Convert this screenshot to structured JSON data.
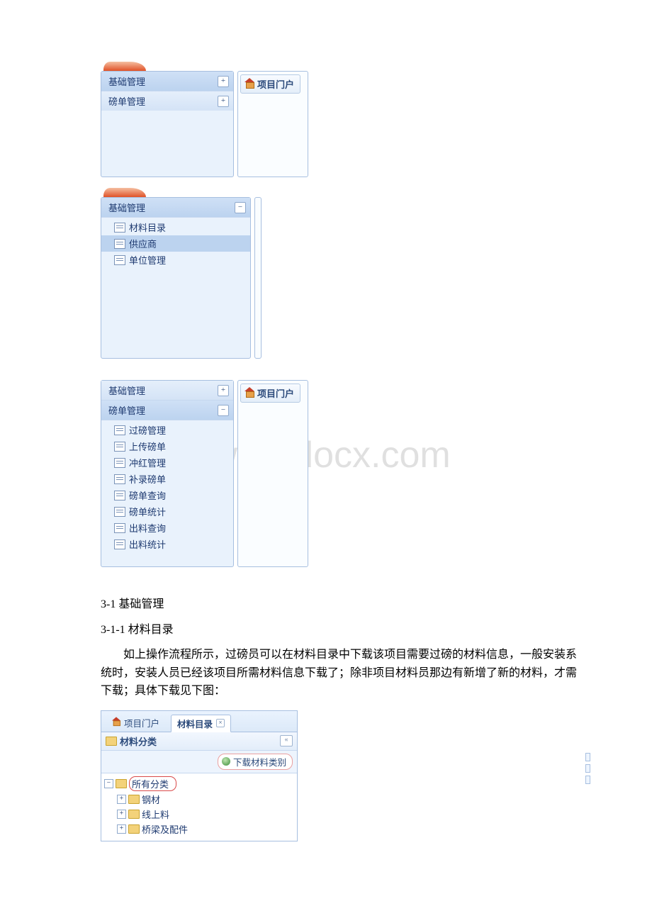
{
  "nav": {
    "basic": "基础管理",
    "weigh": "磅单管理",
    "basic_items": [
      "材料目录",
      "供应商",
      "单位管理"
    ],
    "weigh_items": [
      "过磅管理",
      "上传磅单",
      "冲红管理",
      "补录磅单",
      "磅单查询",
      "磅单统计",
      "出料查询",
      "出料统计"
    ]
  },
  "portal_btn": "项目门户",
  "doc": {
    "h1": "3-1 基础管理",
    "h2": "3-1-1 材料目录",
    "p1": "如上操作流程所示，过磅员可以在材料目录中下载该项目需要过磅的材料信息，一般安装系统时，安装人员已经该项目所需材料信息下载了；除非项目材料员那边有新增了新的材料，才需下载；具体下载见下图："
  },
  "mat": {
    "tab1": "项目门户",
    "tab2": "材料目录",
    "panel_title": "材料分类",
    "download_btn": "下载材料类别",
    "root": "所有分类",
    "children": [
      "钢材",
      "线上料",
      "桥梁及配件"
    ]
  },
  "watermark": "www.bdocx.com"
}
